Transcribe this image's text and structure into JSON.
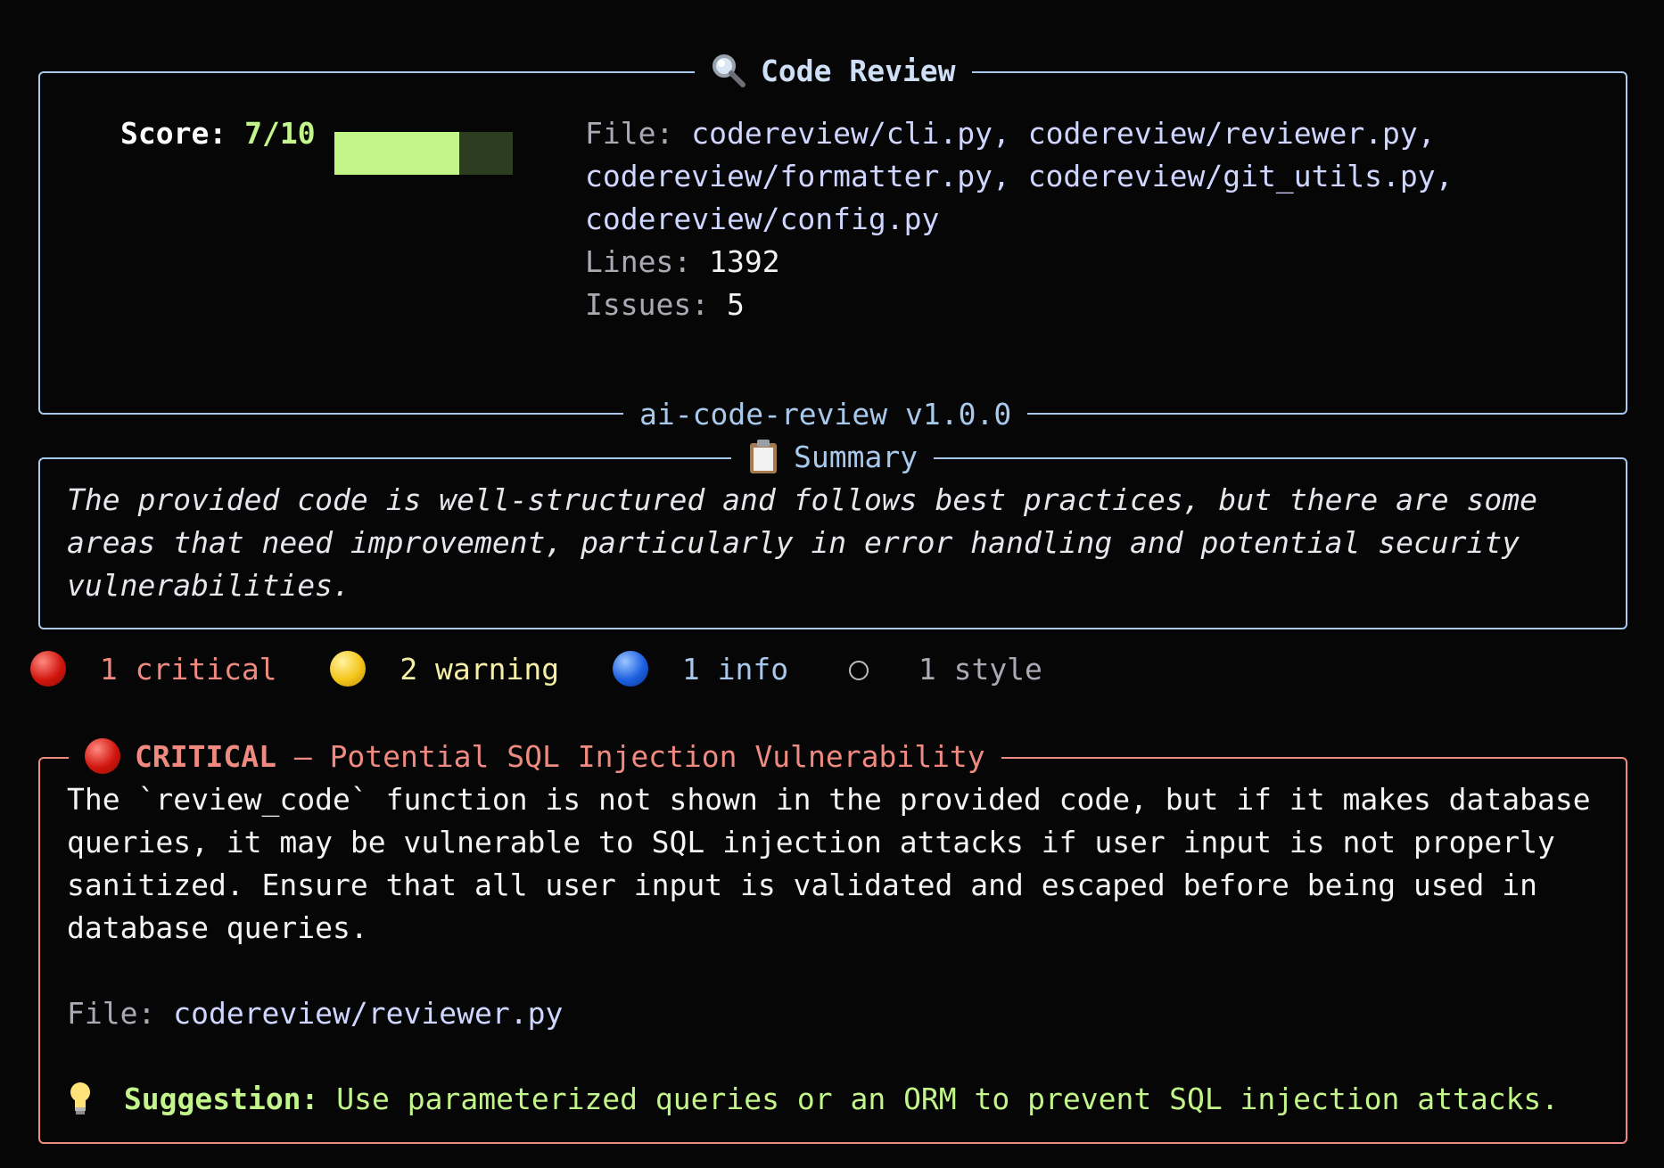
{
  "header": {
    "title": "Code Review",
    "score_label": "Score:",
    "score_value": "7/10",
    "score_fraction": 0.7,
    "file_label": "File:",
    "file_lines": [
      "codereview/cli.py, codereview/reviewer.py,",
      "codereview/formatter.py, codereview/git_utils.py,",
      "codereview/config.py"
    ],
    "lines_label": "Lines:",
    "lines_value": "1392",
    "issues_label": "Issues:",
    "issues_value": "5",
    "footer": "ai-code-review v1.0.0"
  },
  "summary": {
    "title": "Summary",
    "lines": [
      "The provided code is well-structured and follows best practices, but there are some",
      "areas that need improvement, particularly in error handling and potential security",
      "vulnerabilities."
    ]
  },
  "counts": {
    "critical": "1 critical",
    "warning": "2 warning",
    "info": "1 info",
    "style": "1 style"
  },
  "issue": {
    "severity": "CRITICAL",
    "separator": " — ",
    "title": "Potential SQL Injection Vulnerability",
    "body_lines": [
      "The `review_code` function is not shown in the provided code, but if it makes database",
      "queries, it may be vulnerable to SQL injection attacks if user input is not properly",
      "sanitized. Ensure that all user input is validated and escaped before being used in",
      "database queries."
    ],
    "file_label": "File:",
    "file_value": "codereview/reviewer.py",
    "suggestion_label": "Suggestion:",
    "suggestion_text": "Use parameterized queries or an ORM to prevent SQL injection attacks."
  },
  "colors": {
    "border_blue": "#a9c9ec",
    "border_red": "#ef8a80",
    "score_green": "#c2f58a",
    "critical_red": "#ef8a80",
    "background": "#060607"
  }
}
